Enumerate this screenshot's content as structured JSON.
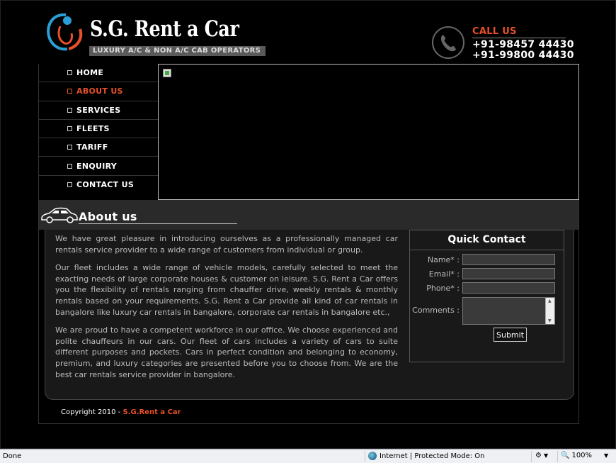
{
  "header": {
    "logo_text": "S.G. Rent a Car",
    "tagline": "LUXURY A/C & NON A/C CAB OPERATORS",
    "call_label": "CALL US",
    "phone1": "+91-98457 44430",
    "phone2": "+91-99800 44430"
  },
  "nav": {
    "items": [
      {
        "label": "HOME"
      },
      {
        "label": "ABOUT US"
      },
      {
        "label": "SERVICES"
      },
      {
        "label": "FLEETS"
      },
      {
        "label": "TARIFF"
      },
      {
        "label": "ENQUIRY"
      },
      {
        "label": "CONTACT US"
      }
    ],
    "active": "ABOUT US"
  },
  "about": {
    "title": "About us",
    "paragraphs": [
      "We have great pleasure in introducing ourselves as a professionally managed car rentals service provider to a wide range of customers from individual or group.",
      "Our fleet includes a wide range of vehicle models, carefully selected to meet the exacting needs of large corporate houses & customer on leisure. S.G. Rent a Car offers you the flexibility of rentals ranging from chauffer drive, weekly rentals & monthly rentals based on your requirements. S.G. Rent a Car provide all kind of car rentals in bangalore like luxury car rentals in bangalore, corporate car rentals in bangalore etc.,",
      "We are proud to have a competent workforce in our office. We choose experienced and polite chauffeurs in our cars. Our fleet of cars includes a variety of cars to suite different purposes and pockets. Cars in perfect condition and belonging to economy, premium, and luxury categories are presented before you to choose from. We are the best car rentals service provider in bangalore."
    ]
  },
  "quick_contact": {
    "title": "Quick Contact",
    "name_label": "Name* :",
    "email_label": "Email* :",
    "phone_label": "Phone* :",
    "comments_label": "Comments :",
    "submit_label": "Submit"
  },
  "footer": {
    "copyright": "Copyright 2010 - ",
    "brand": "S.G.Rent a Car"
  },
  "statusbar": {
    "status": "Done",
    "zone": "Internet | Protected Mode: On",
    "zoom": "100%"
  },
  "colors": {
    "accent": "#e8502a",
    "background": "#000000",
    "panel": "#1a1919"
  }
}
